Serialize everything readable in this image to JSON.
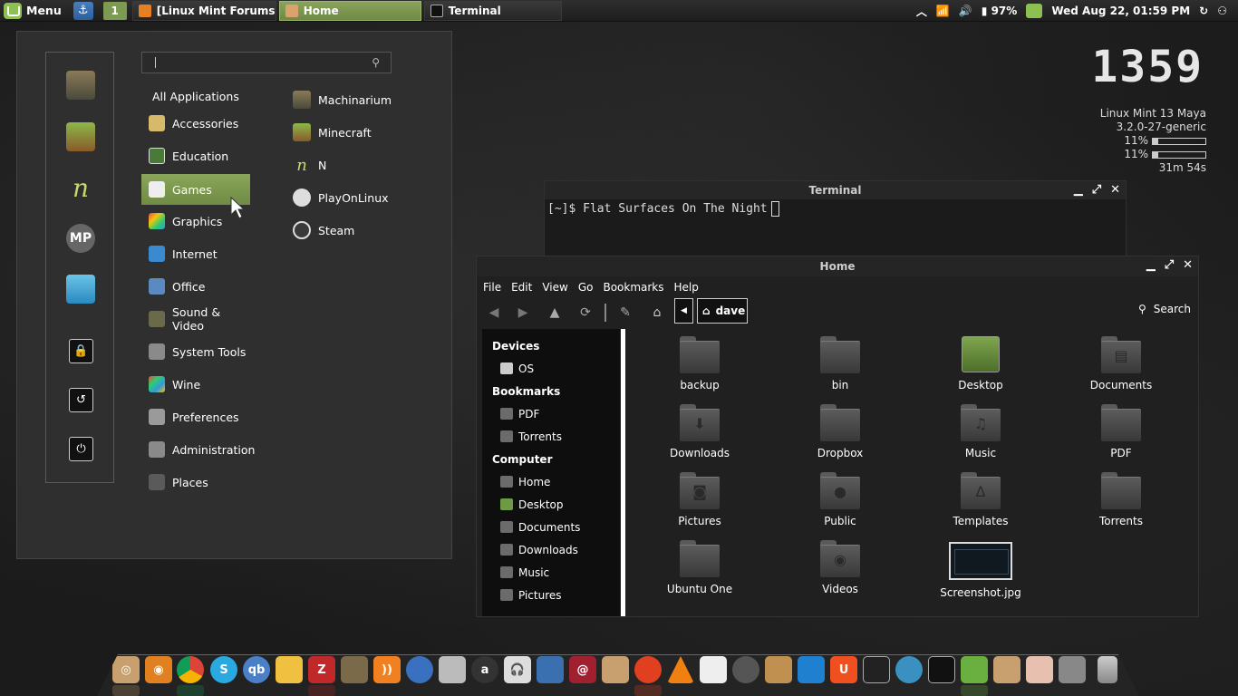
{
  "panel": {
    "menu_label": "Menu",
    "workspace": "1",
    "tasks": [
      {
        "label": "[Linux Mint Forums ...",
        "icon": "firefox-icon"
      },
      {
        "label": "Home",
        "icon": "home-folder-icon"
      },
      {
        "label": "Terminal",
        "icon": "terminal-icon"
      }
    ],
    "battery": "97%",
    "datetime": "Wed Aug 22, 01:59 PM"
  },
  "menu": {
    "search_value": "",
    "categories": [
      "All Applications",
      "Accessories",
      "Education",
      "Games",
      "Graphics",
      "Internet",
      "Office",
      "Sound & Video",
      "System Tools",
      "Wine",
      "Preferences",
      "Administration",
      "Places"
    ],
    "selected_category": "Games",
    "apps": [
      "Machinarium",
      "Minecraft",
      "N",
      "PlayOnLinux",
      "Steam"
    ],
    "favorites": [
      "machinarium-icon",
      "minecraft-icon",
      "n-game-icon",
      "mp-icon",
      "sheep-icon"
    ],
    "favorite_mp": "MP",
    "session_buttons": [
      "lock-icon",
      "logout-icon",
      "power-icon"
    ]
  },
  "conky": {
    "clock": "1359",
    "os": "Linux Mint 13 Maya",
    "kernel": "3.2.0-27-generic",
    "cpu1": "11%",
    "cpu1_value": 0.11,
    "cpu2": "11%",
    "cpu2_value": 0.11,
    "uptime": "31m 54s"
  },
  "terminal": {
    "title": "Terminal",
    "prompt": "[~]$ Flat Surfaces On The Night"
  },
  "file_manager": {
    "title": "Home",
    "menubar": [
      "File",
      "Edit",
      "View",
      "Go",
      "Bookmarks",
      "Help"
    ],
    "path": "dave",
    "search_label": "Search",
    "sidebar": {
      "devices_heading": "Devices",
      "devices": [
        "OS"
      ],
      "bookmarks_heading": "Bookmarks",
      "bookmarks": [
        "PDF",
        "Torrents"
      ],
      "computer_heading": "Computer",
      "computer": [
        "Home",
        "Desktop",
        "Documents",
        "Downloads",
        "Music",
        "Pictures"
      ]
    },
    "files": [
      "backup",
      "bin",
      "Desktop",
      "Documents",
      "Downloads",
      "Dropbox",
      "Music",
      "PDF",
      "Pictures",
      "Public",
      "Templates",
      "Torrents",
      "Ubuntu One",
      "Videos",
      "Screenshot.jpg"
    ]
  },
  "dock": {
    "items": [
      "nautilus-icon",
      "eye-icon",
      "chrome-icon",
      "skype-icon",
      "qbittorrent-icon",
      "cheese-icon",
      "filezilla-icon",
      "gimp-icon",
      "rss-icon",
      "globe-icon",
      "calculator-icon",
      "amazon-icon",
      "headphones-icon",
      "maps-icon",
      "mail-icon",
      "dictionary-icon",
      "disc-icon",
      "vlc-icon",
      "notes-icon",
      "camera-icon",
      "archive-icon",
      "dropbox-icon",
      "ubuntu-one-icon",
      "system-monitor-icon",
      "network-icon",
      "terminal-icon",
      "software-center-icon",
      "package-icon",
      "eye-of-gnome-icon",
      "settings-icon",
      "trash-icon"
    ],
    "labels": {
      "qbittorrent": "qb",
      "amazon": "a",
      "mail": "@",
      "ubuntu_one": "U"
    }
  }
}
